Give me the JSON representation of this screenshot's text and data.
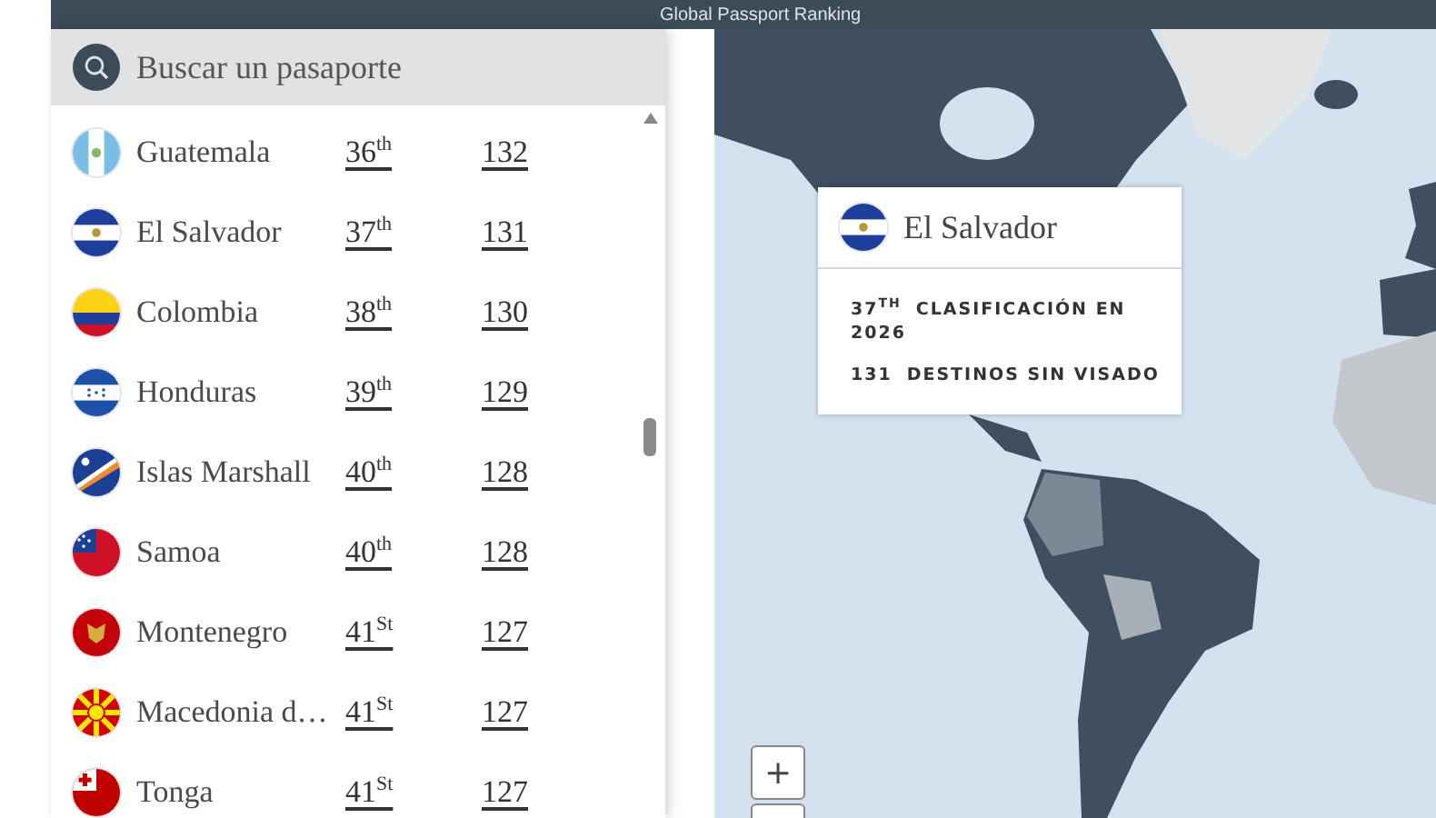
{
  "header": {
    "title": "Global Passport Ranking"
  },
  "search": {
    "placeholder": "Buscar un pasaporte"
  },
  "passports": [
    {
      "country": "Guatemala",
      "rank": "36$^{th}$",
      "destinations": "132"
    },
    {
      "country": "El Salvador",
      "rank": "37$^{th}$",
      "destinations": "131"
    },
    {
      "country": "Colombia",
      "rank": "38$^{th}$",
      "destinations": "130"
    },
    {
      "country": "Honduras",
      "rank": "39$^{th}$",
      "destinations": "129"
    },
    {
      "country": "Islas Marshall",
      "rank": "40$^{th}$",
      "destinations": "128"
    },
    {
      "country": "Samoa",
      "rank": "40$^{th}$",
      "destinations": "128"
    },
    {
      "country": "Montenegro",
      "rank": "41$^{St}$",
      "destinations": "127"
    },
    {
      "country": "Macedonia d…",
      "rank": "41$^{St}$",
      "destinations": "127"
    },
    {
      "country": "Tonga",
      "rank": "41$^{St}$",
      "destinations": "127"
    }
  ],
  "tooltip": {
    "country": "El Salvador",
    "stats": [
      {
        "value": "37$^{TH}$",
        "label": "CLASIFICACIÓN EN 2026"
      },
      {
        "value": "131",
        "label": "DESTINOS SIN VISADO"
      }
    ]
  },
  "map": {
    "kind": "picture",
    "zoom_in": "+"
  }
}
